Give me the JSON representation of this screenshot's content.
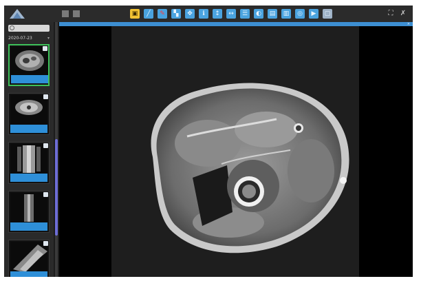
{
  "app": {
    "brand_prefix": "",
    "brand_name": ""
  },
  "sidebar": {
    "search_placeholder": "",
    "study_date": "2020-07-23",
    "series": [
      {
        "caption": "",
        "selected": true
      },
      {
        "caption": "",
        "selected": false
      },
      {
        "caption": "",
        "selected": false
      },
      {
        "caption": "",
        "selected": false
      },
      {
        "caption": "",
        "selected": false
      }
    ]
  },
  "viewport": {
    "header_label": "",
    "overlay_tl": "",
    "overlay_tr": "",
    "overlay_bl": "",
    "overlay_br": "",
    "footer_note": ""
  },
  "colors": {
    "accent": "#3d8fd2",
    "active_tool": "#f2c233",
    "selected_series": "#3ec15a"
  }
}
